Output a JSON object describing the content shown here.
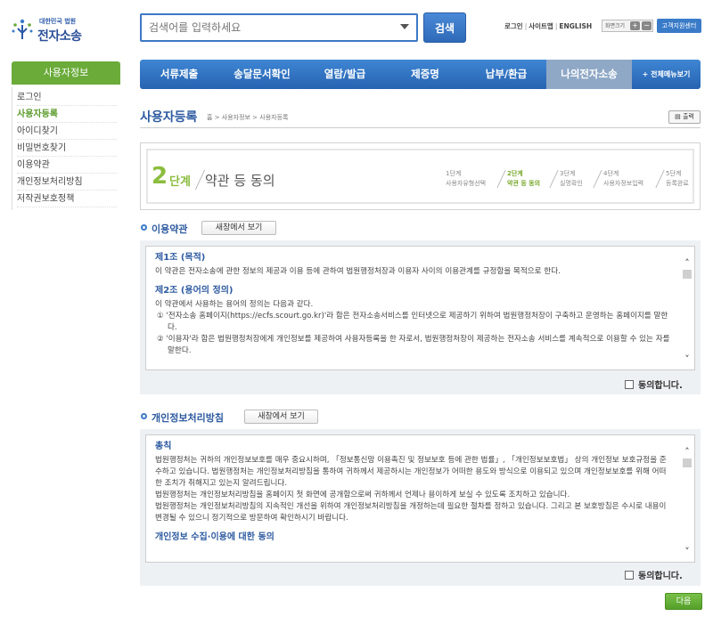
{
  "header": {
    "logo_small": "대한민국 법원",
    "logo_main": "전자소송",
    "search_placeholder": "검색어를 입력하세요",
    "search_button": "검색",
    "util_links": [
      "로그인",
      "사이트맵",
      "ENGLISH"
    ],
    "zoom_label": "화면크기",
    "zoom_plus": "+",
    "zoom_minus": "−",
    "help_center": "고객지원센터"
  },
  "sidebar": {
    "title": "사용자정보",
    "items": [
      "로그인",
      "사용자등록",
      "아이디찾기",
      "비밀번호찾기",
      "이용약관",
      "개인정보처리방침",
      "저작권보호정책"
    ],
    "active_index": 1
  },
  "gnb": {
    "tabs": [
      "서류제출",
      "송달문서확인",
      "열람/발급",
      "제증명",
      "납부/환급",
      "나의전자소송"
    ],
    "all_menu": "+ 전체메뉴보기",
    "active_index": 5
  },
  "page": {
    "title": "사용자등록",
    "breadcrumb": "홈 > 사용자정보 > 사용자등록",
    "print": "출력"
  },
  "step": {
    "number": "2",
    "word": "단계",
    "title": "약관 등 동의",
    "steps": [
      {
        "num": "1단계",
        "label": "사용자유형선택"
      },
      {
        "num": "2단계",
        "label": "약관 등 동의"
      },
      {
        "num": "3단계",
        "label": "실명확인"
      },
      {
        "num": "4단계",
        "label": "사용자정보입력"
      },
      {
        "num": "5단계",
        "label": "등록완료"
      }
    ],
    "active_index": 1
  },
  "terms": {
    "title": "이용약관",
    "new_window": "새창에서 보기",
    "art1_title": "제1조 (목적)",
    "art1_text": "이 약관은 전자소송에 관한 정보의 제공과 이용 등에 관하여 법원행정처장과 이용자 사이의 이용관계를 규정함을 목적으로 한다.",
    "art2_title": "제2조 (용어의 정의)",
    "art2_intro": "이 약관에서 사용하는 용어의 정의는 다음과 같다.",
    "art2_item1": "① '전자소송 홈페이지(https://ecfs.scourt.go.kr)'라 함은 전자소송서비스를 인터넷으로 제공하기 위하여 법원행정처장이 구축하고 운영하는 홈페이지를 말한다.",
    "art2_item2": "② '이용자'라 함은 법원행정처장에게 개인정보를 제공하여 사용자등록을 한 자로서, 법원행정처장이 제공하는 전자소송 서비스를 계속적으로 이용할 수 있는 자를 말한다.",
    "agree": "동의합니다."
  },
  "privacy": {
    "title": "개인정보처리방침",
    "new_window": "새창에서 보기",
    "sec1_title": "총칙",
    "sec1_text1": "법원행정처는 귀하의 개인정보보호를 매우 중요시하며, 「정보통신망 이용촉진 및 정보보호 등에 관한 법률」, 「개인정보보호법」 상의 개인정보 보호규정을 준수하고 있습니다. 법원행정처는 개인정보처리방침을 통하여 귀하께서 제공하시는 개인정보가 어떠한 용도와 방식으로 이용되고 있으며 개인정보보호를 위해 어떠한 조치가 취해지고 있는지 알려드립니다.",
    "sec1_text2": "법원행정처는 개인정보처리방침을 홈페이지 첫 화면에 공개함으로써 귀하께서 언제나 용이하게 보실 수 있도록 조치하고 있습니다.",
    "sec1_text3": "법원행정처는 개인정보처리방침의 지속적인 개선을 위하여 개인정보처리방침을 개정하는데 필요한 절차를 정하고 있습니다. 그리고 본 보호방침은 수시로 내용이 변경될 수 있으니 정기적으로 방문하여 확인하시기 바랍니다.",
    "sec2_title": "개인정보 수집·이용에 대한 동의",
    "agree": "동의합니다."
  },
  "next_button": "다음",
  "colors": {
    "primary_blue": "#2e6ab8",
    "sidebar_green": "#6aab3a",
    "step_green": "#8bbd3f"
  }
}
